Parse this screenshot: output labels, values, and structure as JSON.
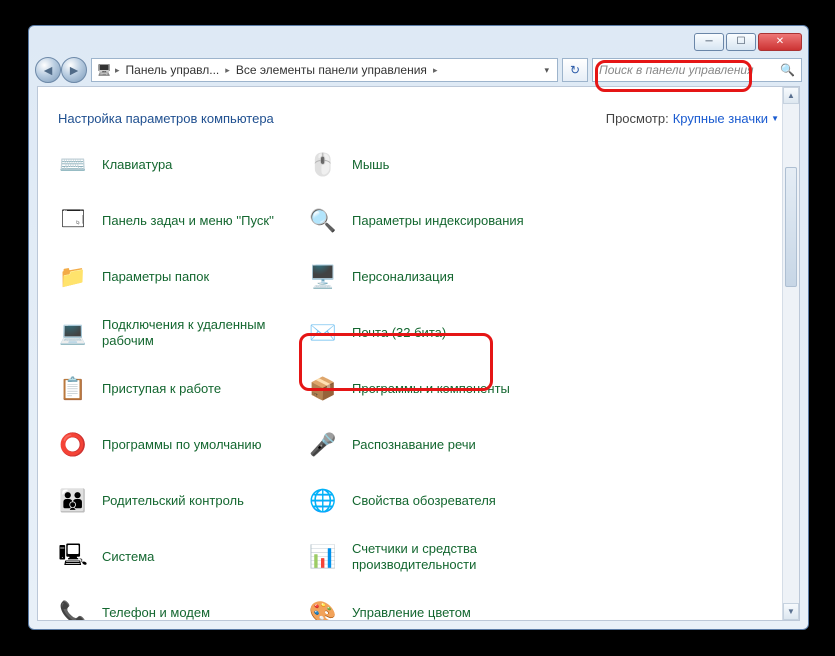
{
  "breadcrumb": {
    "item1": "Панель управл...",
    "item2": "Все элементы панели управления"
  },
  "search": {
    "placeholder": "Поиск в панели управления"
  },
  "header": {
    "title": "Настройка параметров компьютера",
    "view_label": "Просмотр:",
    "view_value": "Крупные значки"
  },
  "items": [
    {
      "label": "Клавиатура",
      "icon": "⌨️"
    },
    {
      "label": "Мышь",
      "icon": "🖱️"
    },
    {
      "label": "Панель задач и меню ''Пуск''",
      "icon": "🗔"
    },
    {
      "label": "Параметры индексирования",
      "icon": "🔍"
    },
    {
      "label": "Параметры папок",
      "icon": "📁"
    },
    {
      "label": "Персонализация",
      "icon": "🖥️"
    },
    {
      "label": "Подключения к удаленным рабочим",
      "icon": "💻"
    },
    {
      "label": "Почта (32 бита)",
      "icon": "✉️"
    },
    {
      "label": "Приступая к работе",
      "icon": "📋"
    },
    {
      "label": "Программы и компоненты",
      "icon": "📦"
    },
    {
      "label": "Программы по умолчанию",
      "icon": "⭕"
    },
    {
      "label": "Распознавание речи",
      "icon": "🎤"
    },
    {
      "label": "Родительский контроль",
      "icon": "👪"
    },
    {
      "label": "Свойства обозревателя",
      "icon": "🌐"
    },
    {
      "label": "Система",
      "icon": "🖳"
    },
    {
      "label": "Счетчики и средства производительности",
      "icon": "📊"
    },
    {
      "label": "Телефон и модем",
      "icon": "📞"
    },
    {
      "label": "Управление цветом",
      "icon": "🎨"
    }
  ]
}
